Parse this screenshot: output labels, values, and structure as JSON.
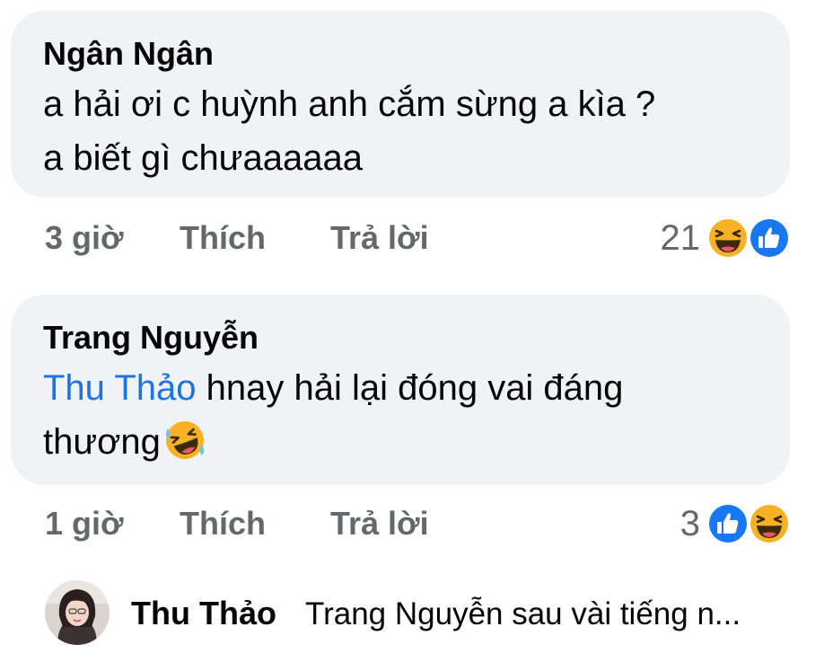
{
  "comments": [
    {
      "author": "Ngân Ngân",
      "text_line1": "a hải ơi c huỳnh anh cắm sừng a kìa ?",
      "text_line2": "a biết gì chưaaaaaa",
      "time": "3 giờ",
      "like_label": "Thích",
      "reply_label": "Trả lời",
      "reaction_count": "21",
      "reactions": [
        "haha-icon",
        "like-icon"
      ]
    },
    {
      "author": "Trang Nguyễn",
      "mention": "Thu Thảo",
      "text_after_mention": " hnay hải lại đóng vai đáng",
      "text_line2": "thương",
      "inline_emoji": "rofl-emoji-icon",
      "time": "1 giờ",
      "like_label": "Thích",
      "reply_label": "Trả lời",
      "reaction_count": "3",
      "reactions": [
        "like-icon",
        "haha-icon"
      ]
    }
  ],
  "reply_preview": {
    "author": "Thu Thảo",
    "snippet": "Trang Nguyễn sau vài tiếng n..."
  },
  "colors": {
    "bubble_bg": "#f0f2f5",
    "mention": "#1b74e4",
    "meta_text": "#65676b",
    "like_blue": "#1877f2",
    "haha_yellow": "#f7b125"
  }
}
